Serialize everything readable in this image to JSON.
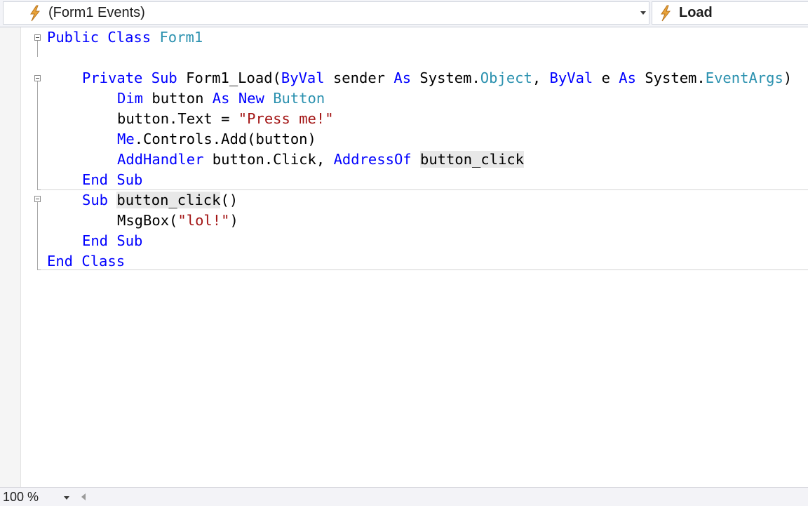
{
  "navbar": {
    "object_selector": {
      "label": "(Form1 Events)",
      "icon": "lightning-bolt-icon"
    },
    "member_selector": {
      "label": "Load",
      "icon": "lightning-bolt-icon"
    }
  },
  "code": {
    "l1": {
      "kw1": "Public",
      "kw2": "Class",
      "type1": "Form1"
    },
    "l3": {
      "kw1": "Private",
      "kw2": "Sub",
      "t1": "Form1_Load(",
      "kw3": "ByVal",
      "t2": " sender ",
      "kw4": "As",
      "t3": " System.",
      "type1": "Object",
      "t4": ", ",
      "kw5": "ByVal",
      "t5": " e ",
      "kw6": "As",
      "t6": " System.",
      "type2": "EventArgs",
      "t7": ")"
    },
    "l4": {
      "kw1": "Dim",
      "t1": " button ",
      "kw2": "As",
      "kw3": "New",
      "type1": "Button"
    },
    "l5": {
      "t1": "button.Text = ",
      "str1": "\"Press me!\""
    },
    "l6": {
      "kw1": "Me",
      "t1": ".Controls.Add(button)"
    },
    "l7": {
      "kw1": "AddHandler",
      "t1": " button.Click, ",
      "kw2": "AddressOf",
      "hl1": "button_click"
    },
    "l8": {
      "kw1": "End",
      "kw2": "Sub"
    },
    "l9": {
      "kw1": "Sub",
      "hl1": "button_click",
      "t1": "()"
    },
    "l10": {
      "t1": "MsgBox(",
      "str1": "\"lol!\"",
      "t2": ")"
    },
    "l11": {
      "kw1": "End",
      "kw2": "Sub"
    },
    "l12": {
      "kw1": "End",
      "kw2": "Class"
    }
  },
  "statusbar": {
    "zoom": "100 %"
  },
  "colors": {
    "keyword": "#0000ff",
    "type": "#2b91af",
    "string": "#a31515",
    "bolt": "#e8a33a"
  }
}
